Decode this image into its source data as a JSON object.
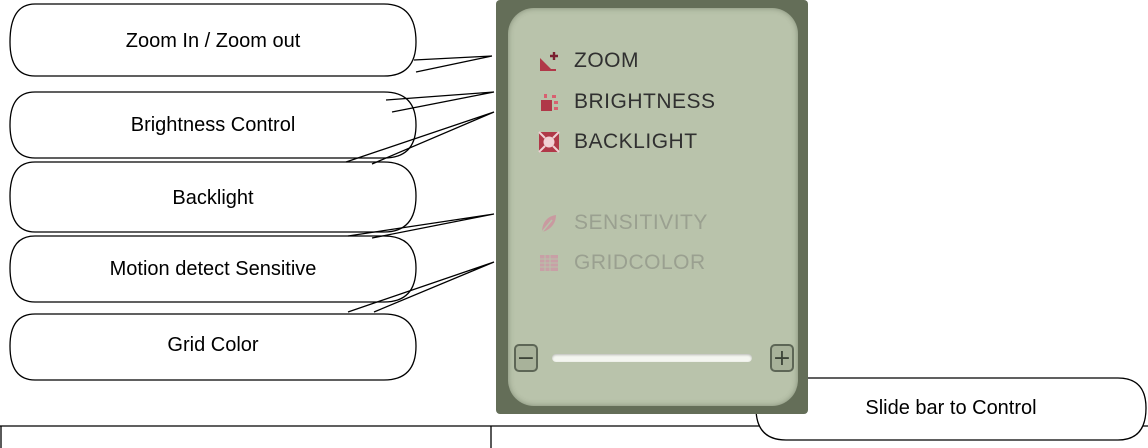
{
  "callouts": {
    "zoom": "Zoom In / Zoom out",
    "brightness": "Brightness Control",
    "backlight": "Backlight",
    "sensitivity": "Motion detect Sensitive",
    "gridcolor": "Grid Color",
    "slider": "Slide bar to Control"
  },
  "panel": {
    "items": [
      {
        "label": "ZOOM",
        "icon": "zoom-icon",
        "enabled": true
      },
      {
        "label": "BRIGHTNESS",
        "icon": "brightness-icon",
        "enabled": true
      },
      {
        "label": "BACKLIGHT",
        "icon": "backlight-icon",
        "enabled": true
      },
      {
        "label": "SENSITIVITY",
        "icon": "leaf-icon",
        "enabled": false
      },
      {
        "label": "GRIDCOLOR",
        "icon": "grid-icon",
        "enabled": false
      }
    ],
    "slider": {
      "minus": "−",
      "plus": "+"
    }
  },
  "colors": {
    "panel_frame": "#646e58",
    "panel_face": "#b9c3ab",
    "icon_accent": "#b03848",
    "disabled_text": "#9aa090"
  }
}
